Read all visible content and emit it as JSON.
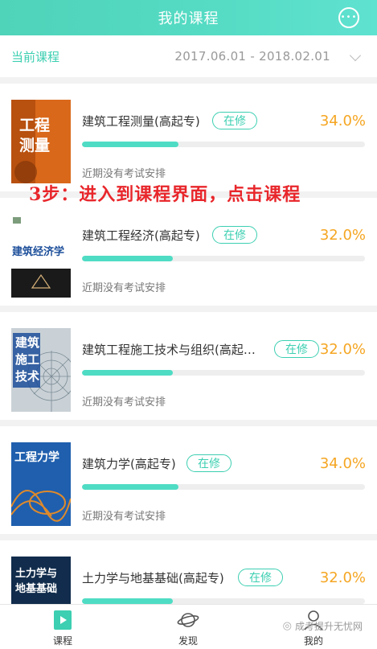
{
  "header": {
    "title": "我的课程",
    "action_icon": "chat-bubble-icon"
  },
  "filter": {
    "label": "当前课程",
    "date_range": "2017.06.01 - 2018.02.01"
  },
  "overlay_note": "3步：进入到课程界面，点击课程",
  "courses": [
    {
      "title": "建筑工程测量(高起专)",
      "status": "在修",
      "percent": "34.0%",
      "progress": 0.34,
      "exam_note": "近期没有考试安排",
      "cover_text": "工程测量"
    },
    {
      "title": "建筑工程经济(高起专)",
      "status": "在修",
      "percent": "32.0%",
      "progress": 0.32,
      "exam_note": "近期没有考试安排",
      "cover_text": "建筑经济学"
    },
    {
      "title": "建筑工程施工技术与组织(高起…",
      "status": "在修",
      "percent": "32.0%",
      "progress": 0.32,
      "exam_note": "近期没有考试安排",
      "cover_text": "建筑施工技术"
    },
    {
      "title": "建筑力学(高起专)",
      "status": "在修",
      "percent": "34.0%",
      "progress": 0.34,
      "exam_note": "近期没有考试安排",
      "cover_text": "工程力学"
    },
    {
      "title": "土力学与地基基础(高起专)",
      "status": "在修",
      "percent": "32.0%",
      "progress": 0.32,
      "exam_note": "",
      "cover_text": "土力学与地基基础"
    }
  ],
  "tabs": [
    {
      "label": "课程",
      "icon": "play-book-icon",
      "active": true
    },
    {
      "label": "发现",
      "icon": "planet-icon",
      "active": false
    },
    {
      "label": "我的",
      "icon": "person-icon",
      "active": false
    }
  ],
  "watermark": "成考提升无忧网",
  "colors": {
    "accent": "#3ccfb1",
    "percent": "#f5a623",
    "overlay": "#e8262b"
  }
}
